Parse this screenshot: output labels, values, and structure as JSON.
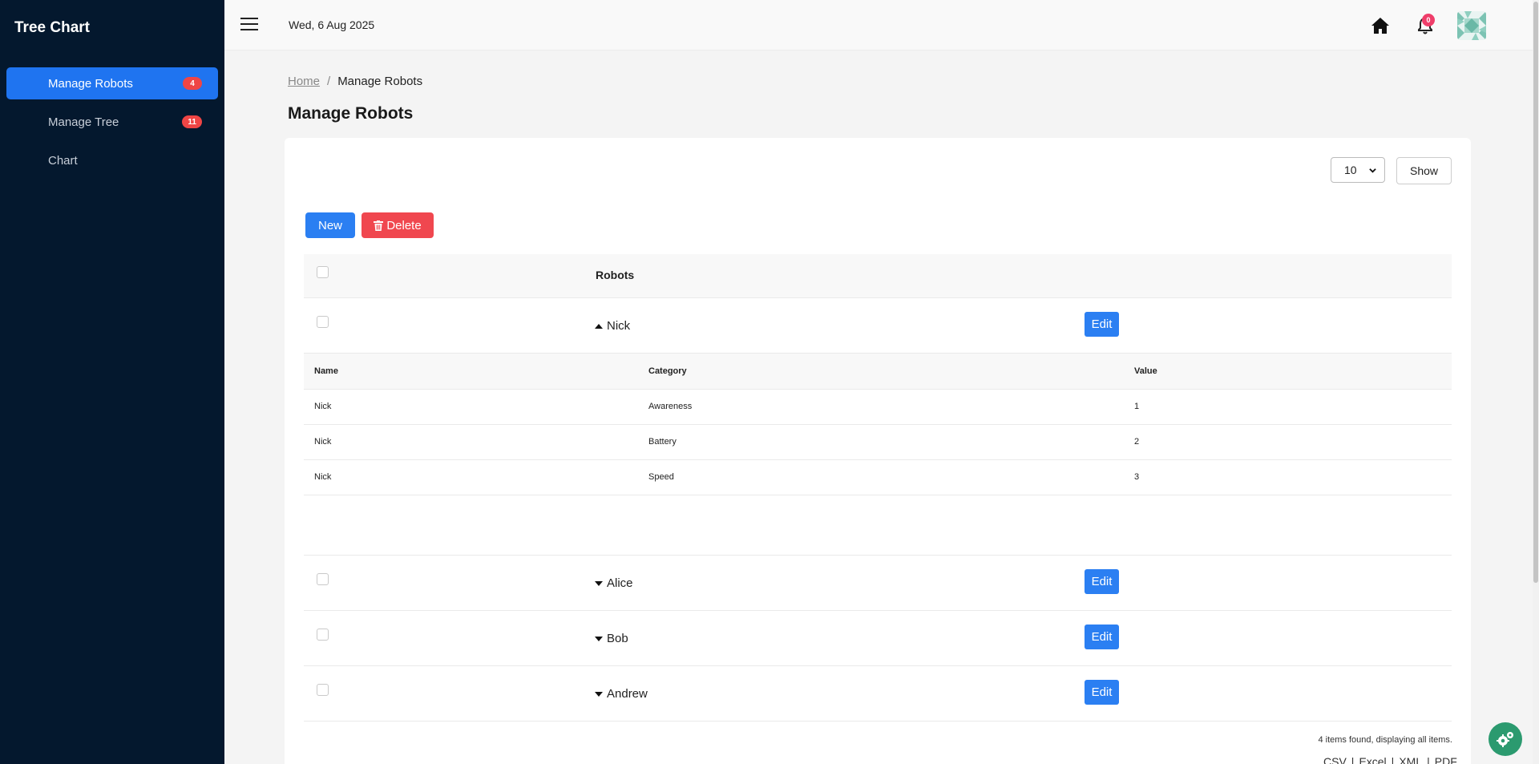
{
  "app": {
    "title": "Tree Chart"
  },
  "sidebar": {
    "items": [
      {
        "label": "Manage Robots",
        "badge": "4",
        "active": true
      },
      {
        "label": "Manage Tree",
        "badge": "11",
        "active": false
      },
      {
        "label": "Chart",
        "badge": "",
        "active": false
      }
    ]
  },
  "topbar": {
    "date": "Wed, 6 Aug 2025",
    "notifications_count": "0",
    "icons": [
      "menu-icon",
      "home-icon",
      "bell-icon",
      "avatar"
    ]
  },
  "breadcrumb": {
    "home": "Home",
    "separator": "/",
    "current": "Manage Robots"
  },
  "page": {
    "title": "Manage Robots"
  },
  "toolbar": {
    "page_size": "10",
    "show_label": "Show",
    "new_label": "New",
    "delete_label": "Delete"
  },
  "grid": {
    "header": "Robots",
    "edit_label": "Edit",
    "robots": [
      {
        "name": "Nick",
        "expanded": true
      },
      {
        "name": "Alice",
        "expanded": false
      },
      {
        "name": "Bob",
        "expanded": false
      },
      {
        "name": "Andrew",
        "expanded": false
      }
    ],
    "detail": {
      "columns": [
        "Name",
        "Category",
        "Value"
      ],
      "rows": [
        [
          "Nick",
          "Awareness",
          "1"
        ],
        [
          "Nick",
          "Battery",
          "2"
        ],
        [
          "Nick",
          "Speed",
          "3"
        ]
      ]
    }
  },
  "footer": {
    "count_text": "4 items found, displaying all items.",
    "exports": [
      "CSV",
      "Excel",
      "XML",
      "PDF"
    ],
    "separator": "|"
  },
  "colors": {
    "sidebar_bg": "#04182e",
    "accent": "#2b7ff2",
    "danger": "#f0474f",
    "badge": "#ef4545",
    "fab": "#2b9a6f"
  }
}
